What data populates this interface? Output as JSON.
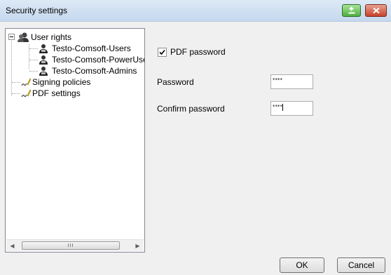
{
  "window": {
    "title": "Security settings",
    "accent": "#c5d8ee"
  },
  "tree": {
    "root": {
      "label": "User rights",
      "icon": "user-group-icon",
      "expanded": true
    },
    "users": [
      {
        "label": "Testo-Comsoft-Users",
        "icon": "user-icon"
      },
      {
        "label": "Testo-Comsoft-PowerUser",
        "icon": "user-icon"
      },
      {
        "label": "Testo-Comsoft-Admins",
        "icon": "user-icon"
      }
    ],
    "others": [
      {
        "label": "Signing policies",
        "icon": "signing-pen-icon"
      },
      {
        "label": "PDF settings",
        "icon": "signing-pen-icon"
      }
    ],
    "scrollbar": {
      "left_icon": "scroll-left-arrow",
      "right_icon": "scroll-right-arrow"
    }
  },
  "pdf": {
    "checkbox_label": "PDF password",
    "checked": true,
    "password_label": "Password",
    "password_value": "****",
    "confirm_label": "Confirm password",
    "confirm_value": "****"
  },
  "buttons": {
    "ok": "OK",
    "cancel": "Cancel"
  }
}
